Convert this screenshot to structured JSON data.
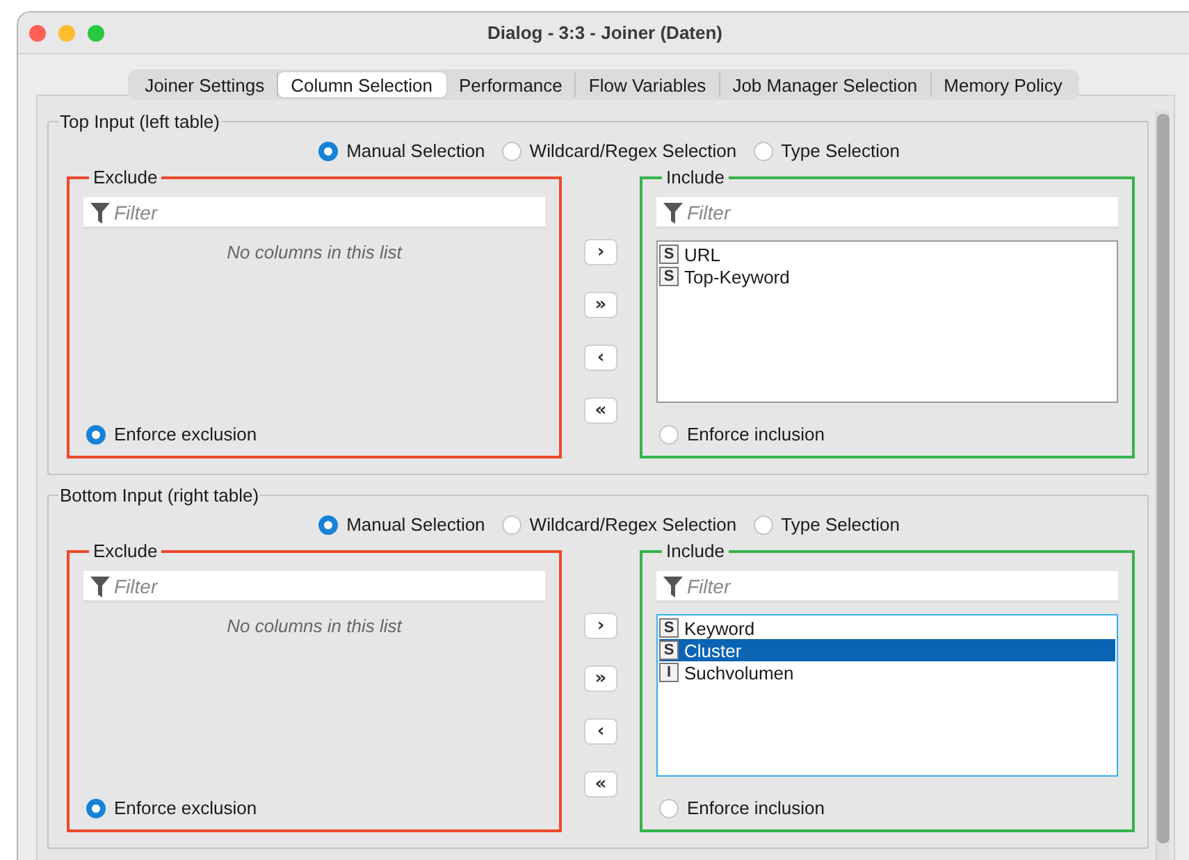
{
  "window": {
    "title": "Dialog - 3:3 - Joiner (Daten)"
  },
  "tabs": [
    {
      "label": "Joiner Settings",
      "selected": false
    },
    {
      "label": "Column Selection",
      "selected": true
    },
    {
      "label": "Performance",
      "selected": false
    },
    {
      "label": "Flow Variables",
      "selected": false
    },
    {
      "label": "Job Manager Selection",
      "selected": false
    },
    {
      "label": "Memory Policy",
      "selected": false
    }
  ],
  "sections": [
    {
      "title": "Top Input (left table)",
      "modes": [
        {
          "label": "Manual Selection",
          "selected": true
        },
        {
          "label": "Wildcard/Regex Selection",
          "selected": false
        },
        {
          "label": "Type Selection",
          "selected": false
        }
      ],
      "exclude": {
        "title": "Exclude",
        "filter_placeholder": "Filter",
        "empty_text": "No columns in this list",
        "enforce": {
          "label": "Enforce exclusion",
          "selected": true
        }
      },
      "move_buttons": [
        "›",
        "»",
        "‹",
        "«"
      ],
      "include": {
        "title": "Include",
        "filter_placeholder": "Filter",
        "focused": false,
        "columns": [
          {
            "type": "S",
            "name": "URL",
            "selected": false
          },
          {
            "type": "S",
            "name": "Top-Keyword",
            "selected": false
          }
        ],
        "enforce": {
          "label": "Enforce inclusion",
          "selected": false
        }
      }
    },
    {
      "title": "Bottom Input (right table)",
      "modes": [
        {
          "label": "Manual Selection",
          "selected": true
        },
        {
          "label": "Wildcard/Regex Selection",
          "selected": false
        },
        {
          "label": "Type Selection",
          "selected": false
        }
      ],
      "exclude": {
        "title": "Exclude",
        "filter_placeholder": "Filter",
        "empty_text": "No columns in this list",
        "enforce": {
          "label": "Enforce exclusion",
          "selected": true
        }
      },
      "move_buttons": [
        "›",
        "»",
        "‹",
        "«"
      ],
      "include": {
        "title": "Include",
        "filter_placeholder": "Filter",
        "focused": true,
        "columns": [
          {
            "type": "S",
            "name": "Keyword",
            "selected": false
          },
          {
            "type": "S",
            "name": "Cluster",
            "selected": true
          },
          {
            "type": "I",
            "name": "Suchvolumen",
            "selected": false
          }
        ],
        "enforce": {
          "label": "Enforce inclusion",
          "selected": false
        }
      }
    }
  ]
}
